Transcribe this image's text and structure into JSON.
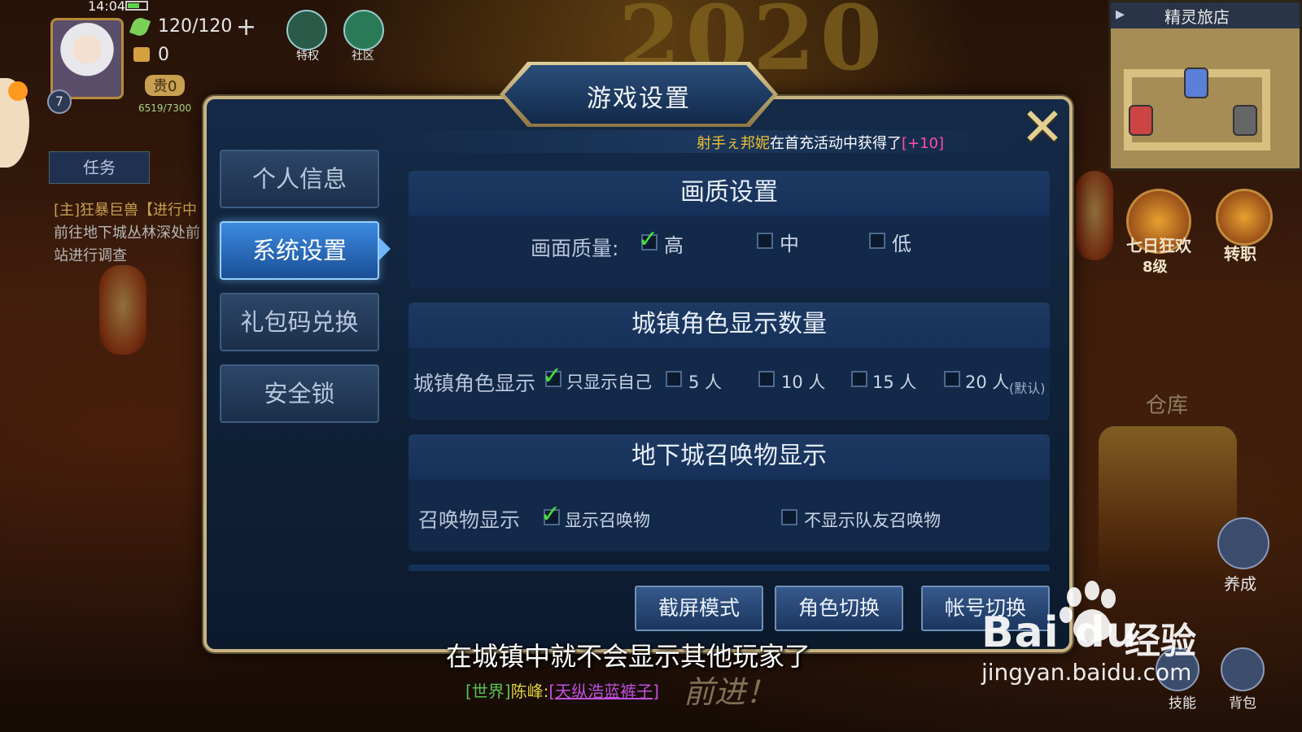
{
  "hud": {
    "time": "14:04",
    "stamina": "120/120",
    "coins": "0",
    "vip": "贵0",
    "level": "7",
    "exp": "6519/7300",
    "privilege_label": "特权",
    "community_label": "社区",
    "task_tab": "任务",
    "task_lines": [
      "[主]狂暴巨兽【进行中",
      "前往地下城丛林深处前",
      "站进行调查"
    ]
  },
  "scene": {
    "banner": "2020"
  },
  "right_hud": {
    "minimap_title": "精灵旅店",
    "event_label": "七日狂欢",
    "event_level": "8级",
    "job_change_label": "转职",
    "warehouse_label": "仓库",
    "nurture_label": "养成",
    "skills_label": "技能",
    "bag_label": "背包"
  },
  "chat": {
    "world_tag": "[世界]",
    "sender": "陈峰:",
    "message": "[天纵浩蓝裤子]",
    "ghost_text": "前进！"
  },
  "dialog": {
    "title": "游戏设置",
    "marquee": {
      "name": "射手ぇ邦妮",
      "text": "在首充活动中获得了",
      "reward": "[+10]"
    },
    "nav": [
      {
        "label": "个人信息",
        "active": false
      },
      {
        "label": "系统设置",
        "active": true
      },
      {
        "label": "礼包码兑换",
        "active": false
      },
      {
        "label": "安全锁",
        "active": false
      }
    ],
    "quality": {
      "header": "画质设置",
      "label": "画面质量:",
      "options": [
        {
          "label": "高",
          "checked": true
        },
        {
          "label": "中",
          "checked": false
        },
        {
          "label": "低",
          "checked": false
        }
      ]
    },
    "town": {
      "header": "城镇角色显示数量",
      "label": "城镇角色显示",
      "options": [
        {
          "label": "只显示自己",
          "checked": true
        },
        {
          "label": "5 人",
          "checked": false
        },
        {
          "label": "10 人",
          "checked": false
        },
        {
          "label": "15 人",
          "checked": false
        },
        {
          "label": "20 人",
          "checked": false
        }
      ],
      "default_tag": "(默认)"
    },
    "summon": {
      "header": "地下城召唤物显示",
      "label": "召唤物显示",
      "options": [
        {
          "label": "显示召唤物",
          "checked": true
        },
        {
          "label": "不显示队友召唤物",
          "checked": false
        }
      ]
    },
    "buttons": {
      "screenshot_mode": "截屏模式",
      "switch_role": "角色切换",
      "switch_account": "帐号切换"
    }
  },
  "caption": "在城镇中就不会显示其他玩家了",
  "watermark": {
    "brand": "Bai du",
    "jingyan": "经验",
    "url": "jingyan.baidu.com"
  }
}
